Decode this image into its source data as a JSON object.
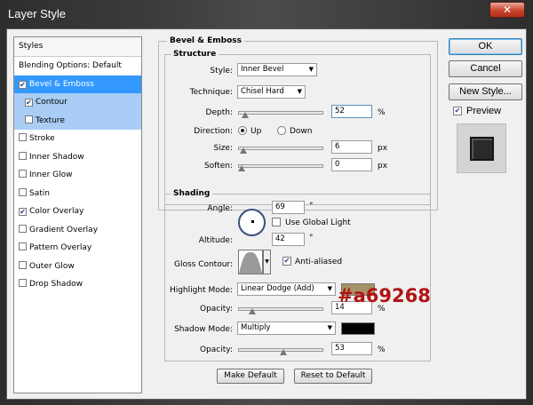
{
  "window": {
    "title": "Layer Style",
    "close_glyph": "✕"
  },
  "styles": {
    "header": "Styles",
    "items": [
      {
        "label": "Blending Options: Default",
        "checkbox": false,
        "checked": false,
        "state": "normal"
      },
      {
        "label": "Bevel & Emboss",
        "checkbox": true,
        "checked": true,
        "state": "selected"
      },
      {
        "label": "Contour",
        "checkbox": true,
        "checked": true,
        "state": "sub"
      },
      {
        "label": "Texture",
        "checkbox": true,
        "checked": false,
        "state": "sub"
      },
      {
        "label": "Stroke",
        "checkbox": true,
        "checked": false,
        "state": "normal"
      },
      {
        "label": "Inner Shadow",
        "checkbox": true,
        "checked": false,
        "state": "normal"
      },
      {
        "label": "Inner Glow",
        "checkbox": true,
        "checked": false,
        "state": "normal"
      },
      {
        "label": "Satin",
        "checkbox": true,
        "checked": false,
        "state": "normal"
      },
      {
        "label": "Color Overlay",
        "checkbox": true,
        "checked": true,
        "state": "normal"
      },
      {
        "label": "Gradient Overlay",
        "checkbox": true,
        "checked": false,
        "state": "normal"
      },
      {
        "label": "Pattern Overlay",
        "checkbox": true,
        "checked": false,
        "state": "normal"
      },
      {
        "label": "Outer Glow",
        "checkbox": true,
        "checked": false,
        "state": "normal"
      },
      {
        "label": "Drop Shadow",
        "checkbox": true,
        "checked": false,
        "state": "normal"
      }
    ]
  },
  "bevel": {
    "section_title": "Bevel & Emboss",
    "structure_title": "Structure",
    "style_label": "Style:",
    "style_value": "Inner Bevel",
    "technique_label": "Technique:",
    "technique_value": "Chisel Hard",
    "depth_label": "Depth:",
    "depth_value": "52",
    "depth_unit": "%",
    "depth_level": 0.05,
    "direction_label": "Direction:",
    "direction_up": "Up",
    "direction_down": "Down",
    "size_label": "Size:",
    "size_value": "6",
    "size_unit": "px",
    "size_level": 0.02,
    "soften_label": "Soften:",
    "soften_value": "0",
    "soften_unit": "px",
    "soften_level": 0.0
  },
  "shading": {
    "title": "Shading",
    "angle_label": "Angle:",
    "angle_value": "69",
    "angle_unit": "°",
    "global_light_label": "Use Global Light",
    "altitude_label": "Altitude:",
    "altitude_value": "42",
    "altitude_unit": "°",
    "gloss_label": "Gloss Contour:",
    "anti_aliased_label": "Anti-aliased",
    "highlight_mode_label": "Highlight Mode:",
    "highlight_mode_value": "Linear Dodge (Add)",
    "highlight_color": "#a69268",
    "hl_opacity_label": "Opacity:",
    "hl_opacity_value": "14",
    "hl_opacity_unit": "%",
    "hl_opacity_level": 0.14,
    "shadow_mode_label": "Shadow Mode:",
    "shadow_mode_value": "Multiply",
    "shadow_color": "#000000",
    "sh_opacity_label": "Opacity:",
    "sh_opacity_value": "53",
    "sh_opacity_unit": "%",
    "sh_opacity_level": 0.53
  },
  "footer": {
    "make_default": "Make Default",
    "reset_default": "Reset to Default"
  },
  "side": {
    "ok": "OK",
    "cancel": "Cancel",
    "new_style": "New Style...",
    "preview": "Preview"
  },
  "annotation": "#a69268"
}
